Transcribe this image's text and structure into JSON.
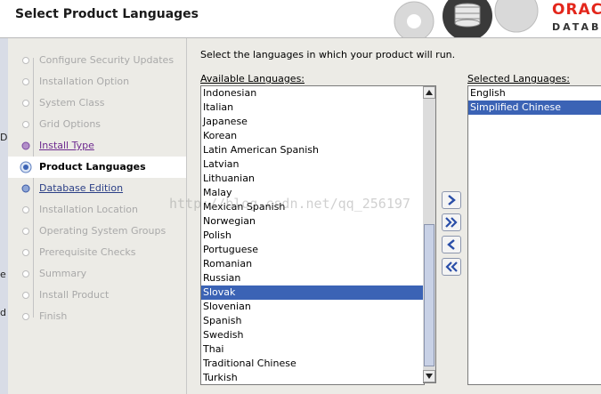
{
  "window": {
    "title": "Select Product Languages"
  },
  "logo": {
    "brand": "ORAC",
    "sub": "DATAB"
  },
  "left_edge": [
    "D",
    "e",
    "d"
  ],
  "steps": [
    {
      "label": "Configure Security Updates",
      "state": "disabled"
    },
    {
      "label": "Installation Option",
      "state": "disabled"
    },
    {
      "label": "System Class",
      "state": "disabled"
    },
    {
      "label": "Grid Options",
      "state": "disabled"
    },
    {
      "label": "Install Type",
      "state": "done"
    },
    {
      "label": "Product Languages",
      "state": "current"
    },
    {
      "label": "Database Edition",
      "state": "link"
    },
    {
      "label": "Installation Location",
      "state": "disabled"
    },
    {
      "label": "Operating System Groups",
      "state": "disabled"
    },
    {
      "label": "Prerequisite Checks",
      "state": "disabled"
    },
    {
      "label": "Summary",
      "state": "disabled"
    },
    {
      "label": "Install Product",
      "state": "disabled"
    },
    {
      "label": "Finish",
      "state": "disabled"
    }
  ],
  "main": {
    "instruction": "Select the languages in which your product will run.",
    "available_label": "Available Languages:",
    "selected_label": "Selected Languages:"
  },
  "available_languages": [
    "Indonesian",
    "Italian",
    "Japanese",
    "Korean",
    "Latin American Spanish",
    "Latvian",
    "Lithuanian",
    "Malay",
    "Mexican Spanish",
    "Norwegian",
    "Polish",
    "Portuguese",
    "Romanian",
    "Russian",
    "Slovak",
    "Slovenian",
    "Spanish",
    "Swedish",
    "Thai",
    "Traditional Chinese",
    "Turkish"
  ],
  "available_selected": "Slovak",
  "selected_languages": [
    "English",
    "Simplified Chinese"
  ],
  "selected_selected": "Simplified Chinese",
  "watermark": "http://blog.csdn.net/qq_256197",
  "colors": {
    "selection": "#3b63b5",
    "done_link": "#6e2a8f",
    "link": "#2b3f86",
    "brand": "#e3261b"
  }
}
